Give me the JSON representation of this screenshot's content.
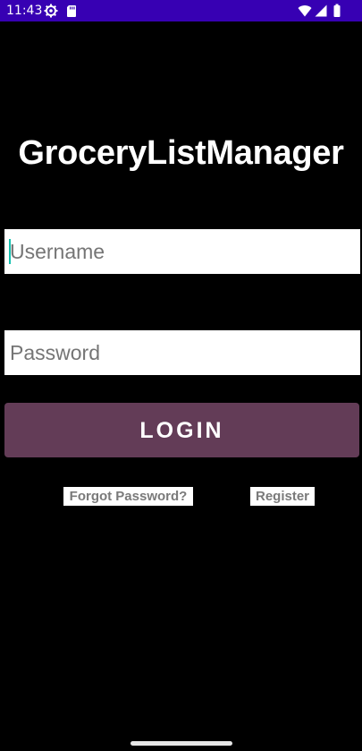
{
  "status_bar": {
    "time": "11:43",
    "background_color": "#3700b3",
    "left_icons": [
      "settings-gear-icon",
      "sd-card-icon"
    ],
    "right_icons": [
      "wifi-icon",
      "cellular-signal-icon",
      "battery-icon"
    ]
  },
  "app": {
    "title": "GroceryListManager"
  },
  "login_form": {
    "username_placeholder": "Username",
    "username_value": "",
    "password_placeholder": "Password",
    "password_value": "",
    "login_label": "LOGIN",
    "forgot_password_label": "Forgot Password?",
    "register_label": "Register"
  },
  "colors": {
    "background": "#000000",
    "login_button": "#633c57",
    "cursor": "#15c1b0",
    "link_text": "#7a7a7a"
  }
}
